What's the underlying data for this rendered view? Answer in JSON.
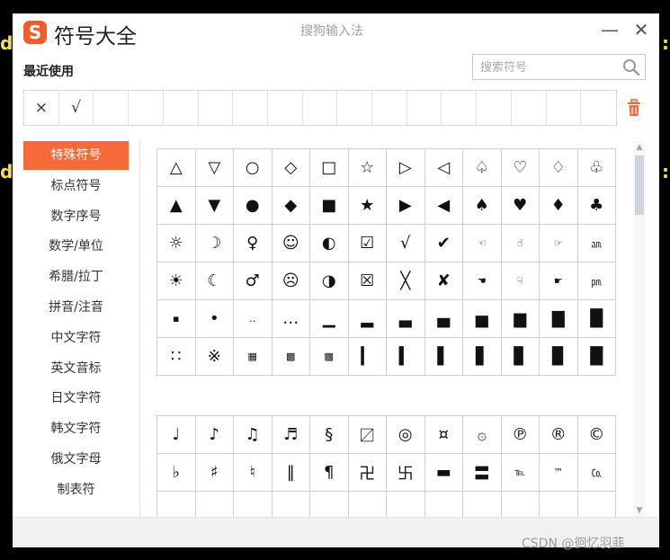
{
  "colors": {
    "accent": "#f86a3a",
    "logo": "#f25c2a",
    "trash": "#f06a35"
  },
  "edge_glyphs": {
    "left1": "d",
    "left2": "d",
    "right1": ":",
    "right2": ":"
  },
  "window": {
    "logo_letter": "S",
    "title": "符号大全",
    "ime_name": "搜狗输入法",
    "minimize": "—",
    "close": "✕"
  },
  "recent": {
    "label": "最近使用",
    "items": [
      "×",
      "√",
      "",
      "",
      "",
      "",
      "",
      "",
      "",
      "",
      "",
      "",
      "",
      "",
      "",
      "",
      ""
    ]
  },
  "search": {
    "placeholder": "搜索符号",
    "value": ""
  },
  "sidebar": {
    "items": [
      "特殊符号",
      "标点符号",
      "数字序号",
      "数学/单位",
      "希腊/拉丁",
      "拼音/注音",
      "中文字符",
      "英文音标",
      "日文字符",
      "韩文字符",
      "俄文字母",
      "制表符"
    ]
  },
  "symbols": {
    "grid1": [
      "△",
      "▽",
      "○",
      "◇",
      "□",
      "☆",
      "▷",
      "◁",
      "♤",
      "♡",
      "♢",
      "♧",
      "▲",
      "▼",
      "●",
      "◆",
      "■",
      "★",
      "▶",
      "◀",
      "♠",
      "♥",
      "♦",
      "♣",
      "☼",
      "☽",
      "♀",
      "☺",
      "◐",
      "☑",
      "√",
      "✔",
      "☜",
      "☝",
      "☞",
      "㏂",
      "☀",
      "☾",
      "♂",
      "☹",
      "◑",
      "☒",
      "╳",
      "✘",
      "☚",
      "☟",
      "☛",
      "㏘",
      "▪",
      "•",
      "‥",
      "…",
      "▁",
      "▂",
      "▃",
      "▄",
      "▅",
      "▆",
      "▇",
      "█",
      "∷",
      "※",
      "▦",
      "▩",
      "▩",
      "▎",
      "▍",
      "▌",
      "▋",
      "▊",
      "▉",
      "█"
    ],
    "grid2": [
      "♩",
      "♪",
      "♫",
      "♬",
      "§",
      "〼",
      "◎",
      "¤",
      "۞",
      "℗",
      "®",
      "©",
      "♭",
      "♯",
      "♮",
      "‖",
      "¶",
      "卍",
      "卐",
      "▬",
      "〓",
      "℡",
      "™",
      "㏇",
      "",
      "",
      "",
      "",
      "",
      "",
      "",
      "",
      "",
      "",
      "",
      ""
    ]
  },
  "watermark": "CSDN @徊忆羽菲"
}
